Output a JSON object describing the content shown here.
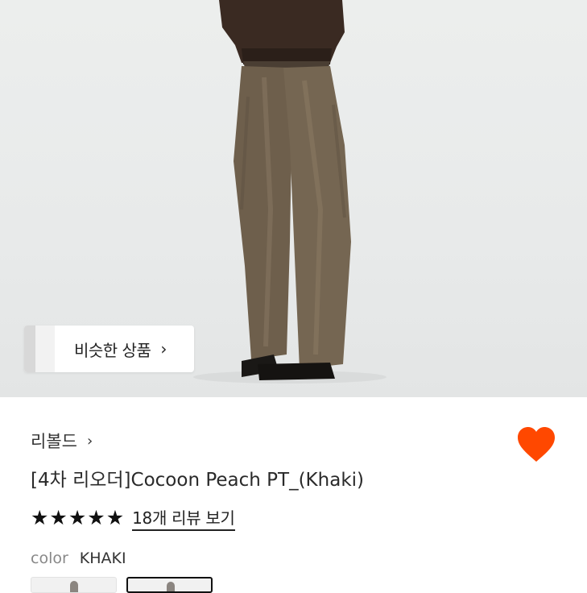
{
  "similar_products": {
    "label": "비슷한 상품",
    "chevron": "›"
  },
  "product": {
    "brand": "리볼드",
    "brand_chevron": "›",
    "title": "[4차 리오더]Cocoon Peach PT_(Khaki)",
    "rating_stars": 5,
    "reviews_label": "18개 리뷰 보기",
    "color_label": "color",
    "color_value": "KHAKI",
    "wishlist_color": "#ff4800"
  },
  "icons": {
    "heart": "heart-icon",
    "star": "star-icon",
    "chevron": "chevron-right-icon"
  }
}
